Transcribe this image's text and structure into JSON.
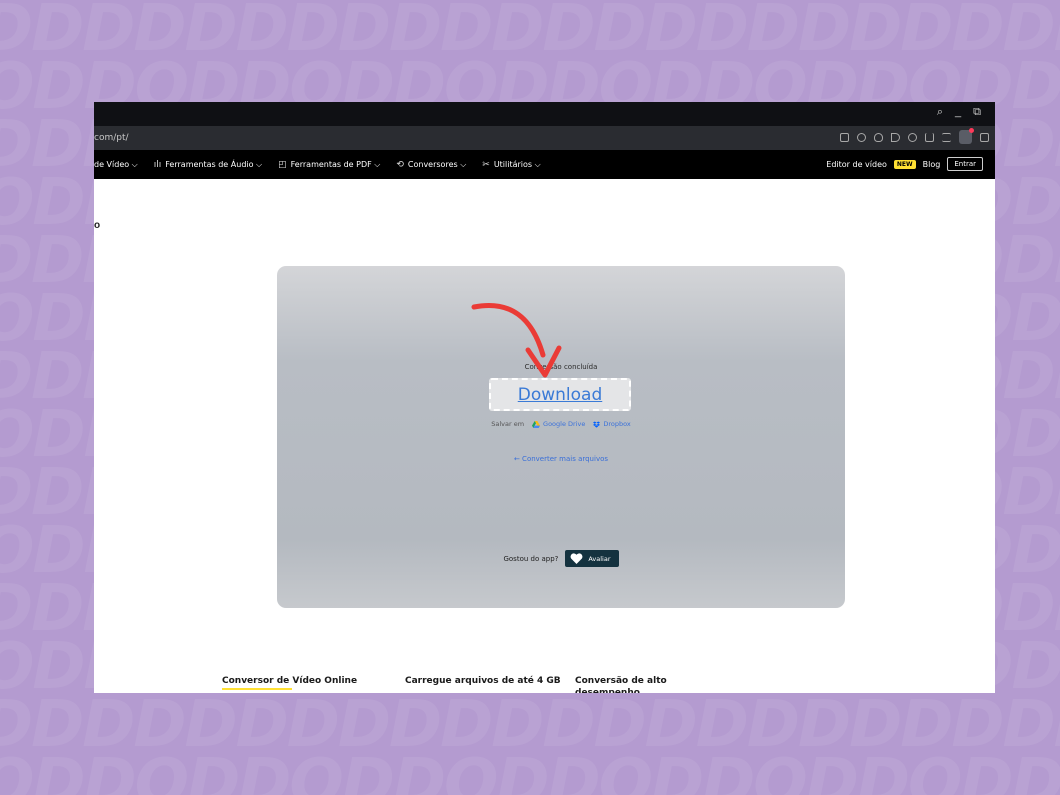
{
  "browser": {
    "url": "com/pt/",
    "title_controls": [
      "⌕",
      "_",
      "⧉"
    ]
  },
  "nav": {
    "items": [
      {
        "icon": "",
        "label": "de Vídeo ⌵"
      },
      {
        "icon": "ılı",
        "label": "Ferramentas de Áudio ⌵"
      },
      {
        "icon": "◰",
        "label": "Ferramentas de PDF ⌵"
      },
      {
        "icon": "⟲",
        "label": "Conversores ⌵"
      },
      {
        "icon": "✂",
        "label": "Utilitários ⌵"
      }
    ],
    "editor_label": "Editor de vídeo",
    "new_badge": "NEW",
    "blog": "Blog",
    "login": "Entrar"
  },
  "page": {
    "heading_fragment": "o"
  },
  "card": {
    "status": "Conversão concluída",
    "download": "Download",
    "save_in": "Salvar em",
    "google_drive": "Google Drive",
    "dropbox": "Dropbox",
    "more": "← Converter mais arquivos",
    "liked": "Gostou do app?",
    "rate": "Avaliar"
  },
  "features": [
    "Conversor de Vídeo Online",
    "Carregue arquivos de até 4 GB",
    "Conversão de alto desempenho"
  ],
  "colors": {
    "background": "#b49bd0",
    "accent_blue": "#3a7ad6",
    "annotation_arrow": "#ea3b36",
    "new_badge": "#ffe033"
  }
}
